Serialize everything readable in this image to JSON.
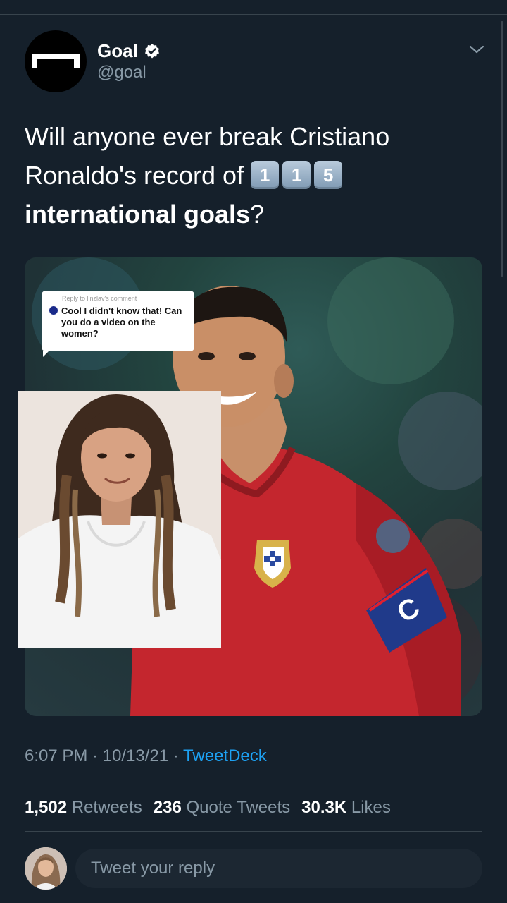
{
  "tweet": {
    "author_name": "Goal",
    "author_handle": "@goal",
    "text_line1": "Will anyone ever break Cristiano",
    "text_line2": "Ronaldo's record of",
    "keycaps": [
      "1",
      "1",
      "5"
    ],
    "text_bold": "international goals",
    "text_end": "?",
    "time": "6:07 PM",
    "separator": " · ",
    "date": "10/13/21",
    "source": "TweetDeck"
  },
  "stats": {
    "retweets_count": "1,502",
    "retweets_label": "Retweets",
    "quotes_count": "236",
    "quotes_label": "Quote Tweets",
    "likes_count": "30.3K",
    "likes_label": "Likes"
  },
  "reply_sticker": {
    "caption": "Reply to linzlav's comment",
    "text": "Cool I didn't know that! Can you do a video on the women?"
  },
  "media": {
    "armband_letter": "C"
  },
  "reply": {
    "placeholder": "Tweet your reply"
  },
  "icons": {
    "verified": "verified-badge-icon",
    "chevron": "chevron-down-icon"
  },
  "colors": {
    "background": "#15202b",
    "link": "#1da1f2",
    "secondary_text": "#8899a6",
    "divider": "#38444d"
  }
}
